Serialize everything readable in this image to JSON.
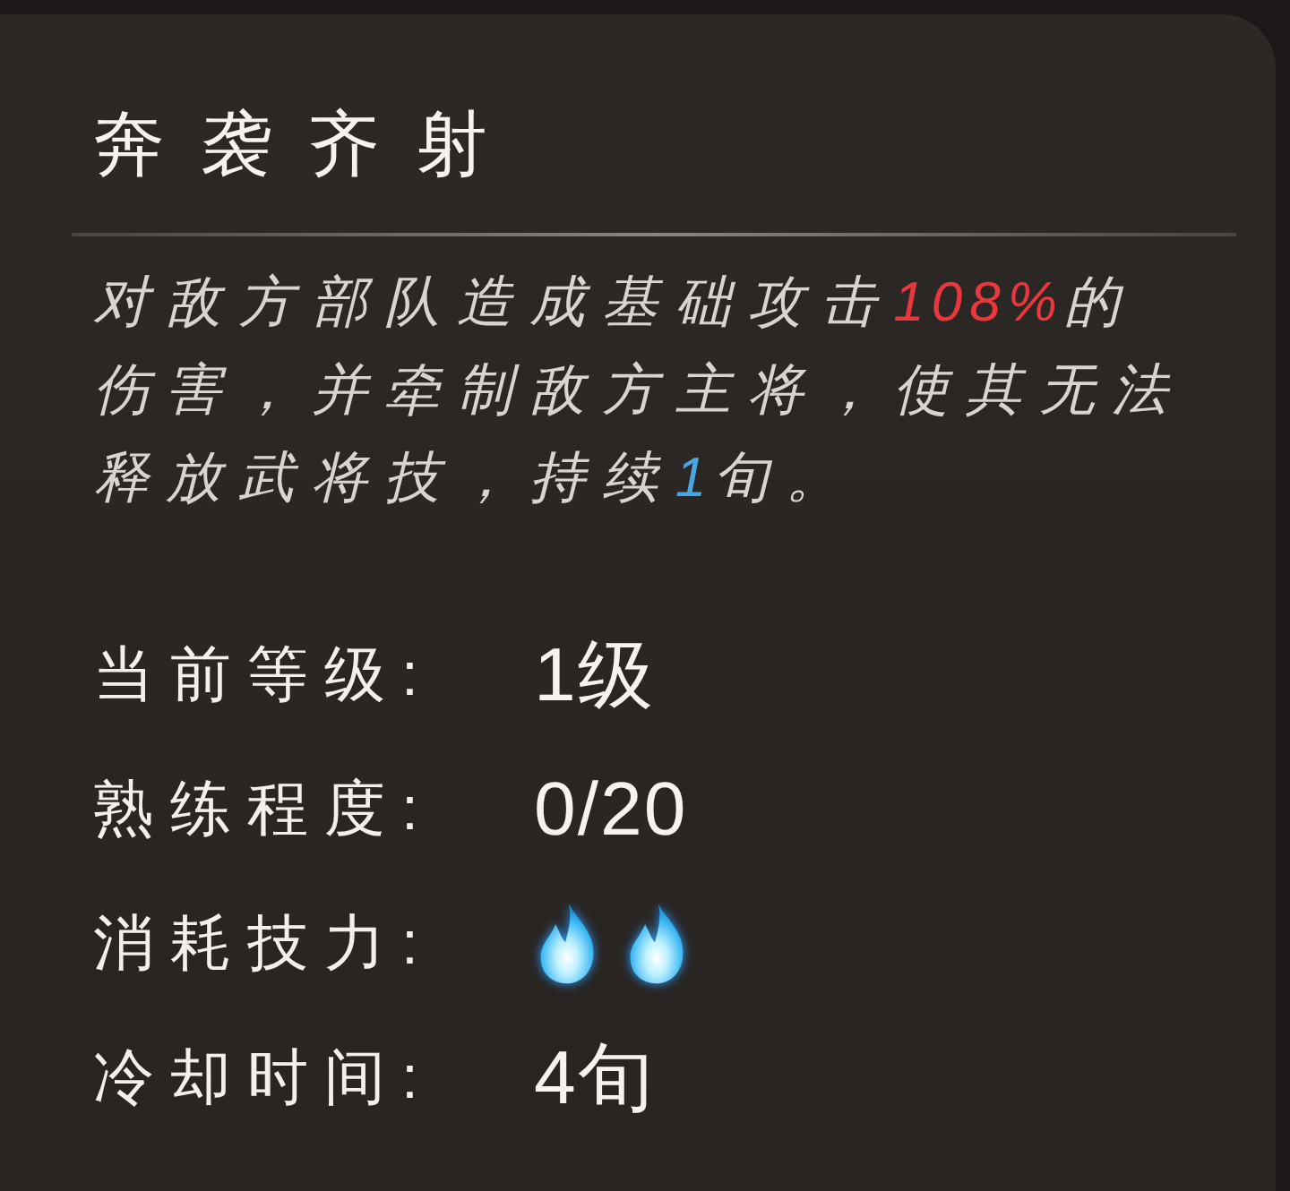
{
  "skill": {
    "title": "奔袭齐射",
    "description": [
      {
        "text": "对敌方部队造成基础攻击"
      },
      {
        "text": "108%",
        "color": "#e8383d"
      },
      {
        "text": "的伤害，并牵制敌方主将，使其无法释放武将技，持续"
      },
      {
        "text": "1",
        "color": "#4aa6e0"
      },
      {
        "text": "旬。"
      }
    ],
    "stats": [
      {
        "kind": "text",
        "label": "当前等级:",
        "value": "1级"
      },
      {
        "kind": "text",
        "label": "熟练程度:",
        "value": "0/20"
      },
      {
        "kind": "cost",
        "label": "消耗技力:",
        "flames": [
          {
            "lit": true
          },
          {
            "lit": true
          }
        ]
      },
      {
        "kind": "text",
        "label": "冷却时间:",
        "value": "4旬"
      }
    ]
  }
}
